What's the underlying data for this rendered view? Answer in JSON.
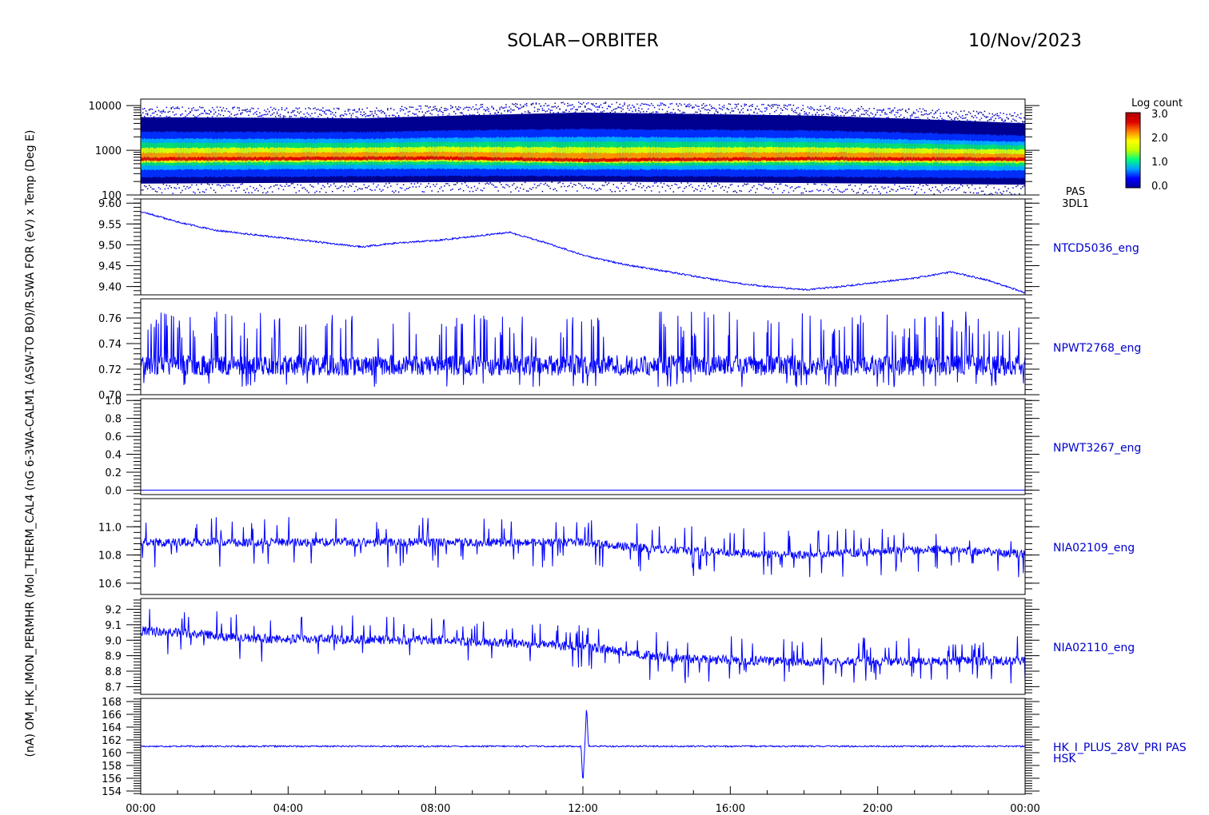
{
  "header": {
    "mission": "SOLAR−ORBITER",
    "date": "10/Nov/2023"
  },
  "colorbar": {
    "title": "Log count",
    "ticks": [
      "3.0",
      "2.0",
      "1.0",
      "0.0"
    ],
    "stops": [
      "#0000a0",
      "#0000ff",
      "#00a0ff",
      "#00ff80",
      "#c0ff00",
      "#ffff00",
      "#ff8000",
      "#e00000",
      "#b00000"
    ]
  },
  "y_axis_stacked_label": "(nA) OM_HK_IMON_PERMHR (Mol_THERM_CAL4 (nG 6-3WA-CALM1 (ASW-TO BO)/R.SWA FOR (eV) x Temp (Deg E)",
  "chart_data": {
    "type": "line",
    "time_range_hours": [
      0,
      24
    ],
    "x_tick_labels": [
      "00:00",
      "04:00",
      "08:00",
      "12:00",
      "16:00",
      "20:00",
      "00:00"
    ],
    "panels": [
      {
        "kind": "spectrogram",
        "y_scale": "log",
        "ylim": [
          100,
          14000
        ],
        "y_ticks": [
          "10000",
          "1000",
          "100"
        ],
        "y_tick_values": [
          10000,
          1000,
          100
        ],
        "labels": [
          "PAS",
          "3DL1"
        ],
        "peak_energy_eV": {
          "x": [
            0,
            8,
            12,
            18,
            24
          ],
          "y": [
            650,
            680,
            620,
            660,
            640
          ]
        },
        "band_upper_eV": {
          "x": [
            0,
            6,
            12,
            18,
            24
          ],
          "y": [
            5500,
            5200,
            7000,
            6000,
            4000
          ]
        },
        "band_lower_eV": {
          "x": [
            0,
            12,
            24
          ],
          "y": [
            180,
            200,
            170
          ]
        }
      },
      {
        "kind": "line",
        "name": "NTCD5036_eng",
        "ylim": [
          9.38,
          9.61
        ],
        "y_ticks": [
          "9.60",
          "9.55",
          "9.50",
          "9.45",
          "9.40"
        ],
        "y_tick_values": [
          9.6,
          9.55,
          9.5,
          9.45,
          9.4
        ],
        "x": [
          0,
          1,
          2,
          3,
          4,
          5,
          6,
          7,
          8,
          9,
          10,
          11,
          12,
          13,
          14,
          15,
          16,
          17,
          18,
          19,
          20,
          21,
          22,
          23,
          24
        ],
        "y": [
          9.58,
          9.555,
          9.535,
          9.525,
          9.515,
          9.505,
          9.495,
          9.505,
          9.51,
          9.52,
          9.53,
          9.505,
          9.475,
          9.455,
          9.44,
          9.425,
          9.41,
          9.4,
          9.392,
          9.4,
          9.41,
          9.42,
          9.435,
          9.415,
          9.385
        ],
        "noise": 0.002
      },
      {
        "kind": "noise",
        "name": "NPWT2768_eng",
        "ylim": [
          0.7,
          0.775
        ],
        "y_ticks": [
          "0.76",
          "0.74",
          "0.72",
          "0.70"
        ],
        "y_tick_values": [
          0.76,
          0.74,
          0.72,
          0.7
        ],
        "base": 0.723,
        "spread": 0.008,
        "spike_high": 0.765,
        "spike_low": 0.706
      },
      {
        "kind": "line",
        "name": "NPWT3267_eng",
        "ylim": [
          -0.05,
          1.02
        ],
        "y_ticks": [
          "1.0",
          "0.8",
          "0.6",
          "0.4",
          "0.2",
          "0.0"
        ],
        "y_tick_values": [
          1.0,
          0.8,
          0.6,
          0.4,
          0.2,
          0.0
        ],
        "x": [
          0,
          24
        ],
        "y": [
          0.0,
          0.0
        ],
        "noise": 0
      },
      {
        "kind": "steps",
        "name": "NIA02109_eng",
        "ylim": [
          10.52,
          11.2
        ],
        "y_ticks": [
          "11.0",
          "10.8",
          "10.6"
        ],
        "y_tick_values": [
          11.0,
          10.8,
          10.6
        ],
        "levels": {
          "x": [
            0,
            12,
            14.5,
            18,
            21.5,
            24
          ],
          "y": [
            10.89,
            10.89,
            10.83,
            10.8,
            10.84,
            10.81
          ]
        },
        "spread": 0.06,
        "spike": 0.18
      },
      {
        "kind": "steps",
        "name": "NIA02110_eng",
        "ylim": [
          8.65,
          9.27
        ],
        "y_ticks": [
          "9.2",
          "9.1",
          "9.0",
          "8.9",
          "8.8",
          "8.7"
        ],
        "y_tick_values": [
          9.2,
          9.1,
          9.0,
          8.9,
          8.8,
          8.7
        ],
        "levels": {
          "x": [
            0,
            1,
            3,
            8,
            12,
            14.5,
            18,
            24
          ],
          "y": [
            9.06,
            9.05,
            9.01,
            9.0,
            8.96,
            8.88,
            8.86,
            8.87
          ]
        },
        "spread": 0.06,
        "spike": 0.16
      },
      {
        "kind": "line",
        "name": "HK_I_PLUS_28V_PRI PAS",
        "name2": "HSK",
        "ylim": [
          153.5,
          168.5
        ],
        "y_ticks": [
          "168",
          "166",
          "164",
          "162",
          "160",
          "158",
          "156",
          "154"
        ],
        "y_tick_values": [
          168,
          166,
          164,
          162,
          160,
          158,
          156,
          154
        ],
        "x": [
          0,
          11.95,
          12.0,
          12.05,
          12.1,
          12.15,
          24
        ],
        "y": [
          161.0,
          161.0,
          155.0,
          161.0,
          167.5,
          161.0,
          161.0
        ],
        "noise": 0.12
      }
    ]
  }
}
